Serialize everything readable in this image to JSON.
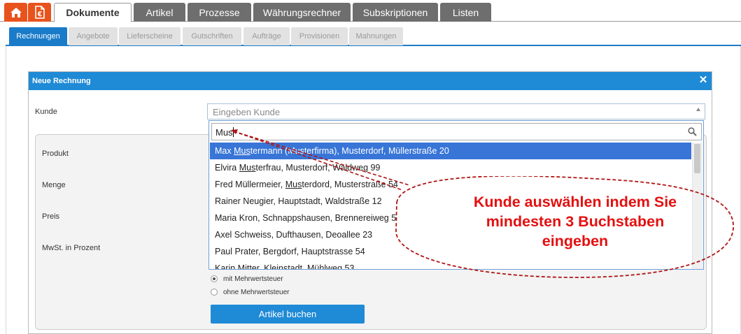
{
  "nav": {
    "home_icon": "home-icon",
    "docs_icon": "document-euro-icon",
    "tabs": [
      {
        "label": "Dokumente",
        "active": true
      },
      {
        "label": "Artikel",
        "active": false
      },
      {
        "label": "Prozesse",
        "active": false
      },
      {
        "label": "Währungsrechner",
        "active": false
      },
      {
        "label": "Subskriptionen",
        "active": false
      },
      {
        "label": "Listen",
        "active": false
      }
    ]
  },
  "subnav": {
    "tabs": [
      {
        "label": "Rechnungen",
        "active": true
      },
      {
        "label": "Angebote",
        "active": false
      },
      {
        "label": "Lieferscheine",
        "active": false
      },
      {
        "label": "Gutschriften",
        "active": false
      },
      {
        "label": "Aufträge",
        "active": false
      },
      {
        "label": "Provisionen",
        "active": false
      },
      {
        "label": "Mahnungen",
        "active": false
      }
    ]
  },
  "dialog": {
    "title": "Neue Rechnung",
    "close_icon": "close-icon",
    "labels": {
      "kunde": "Kunde",
      "produkt": "Produkt",
      "menge": "Menge",
      "preis": "Preis",
      "mwst": "MwSt. in Prozent"
    },
    "kunde_select": {
      "placeholder": "Eingeben Kunde",
      "search_value": "Mus",
      "results": [
        {
          "before": "Max ",
          "match": "Mus",
          "after": "termann (Musterfirma), Musterdorf, Müllerstraße 20",
          "selected": true
        },
        {
          "before": "Elvira ",
          "match": "Mus",
          "after": "terfrau, Musterdorf, Waldweg 99",
          "selected": false
        },
        {
          "before": "Fred Müllermeier, ",
          "match": "Mus",
          "after": "terdord, Musterstraße 54",
          "selected": false
        },
        {
          "before": "Rainer Neugier, Hauptstadt, Waldstraße 12",
          "match": "",
          "after": "",
          "selected": false
        },
        {
          "before": "Maria Kron, Schnappshausen, Brennereiweg 5",
          "match": "",
          "after": "",
          "selected": false
        },
        {
          "before": "Axel Schweiss, Dufthausen, Deoallee 23",
          "match": "",
          "after": "",
          "selected": false
        },
        {
          "before": "Paul Prater, Bergdorf, Hauptstrasse 54",
          "match": "",
          "after": "",
          "selected": false
        },
        {
          "before": "Karin Mitter, Kleinstadt, Mühlweg 53",
          "match": "",
          "after": "",
          "selected": false
        }
      ]
    },
    "tax_options": [
      {
        "label": "mit Mehrwertsteuer",
        "checked": true
      },
      {
        "label": "ohne Mehrwertsteuer",
        "checked": false
      }
    ],
    "book_button": "Artikel buchen"
  },
  "annotation": {
    "lines": [
      "Kunde auswählen indem Sie",
      "mindesten 3 Buchstaben",
      "eingeben"
    ],
    "color": "#e40f0f"
  }
}
